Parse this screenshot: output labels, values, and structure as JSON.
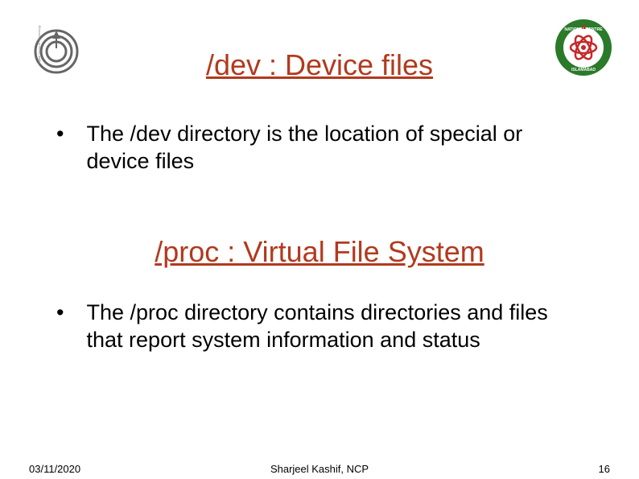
{
  "title1": "/dev : Device files",
  "bullet1": "The /dev directory is the location of special or device files",
  "title2": "/proc : Virtual File System",
  "bullet2": "The /proc directory contains directories and files that report system information and status",
  "date": "03/11/2020",
  "author": "Sharjeel Kashif, NCP",
  "page": "16"
}
